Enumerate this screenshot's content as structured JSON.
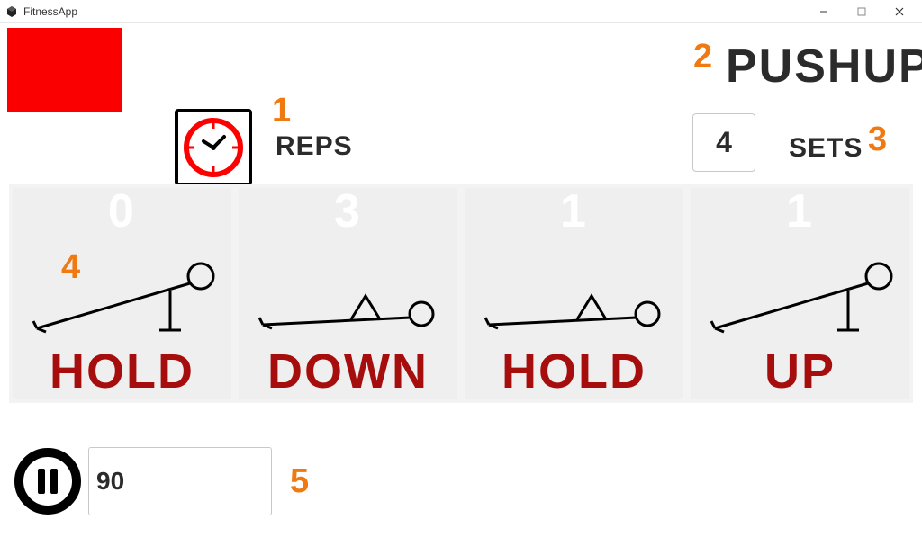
{
  "window": {
    "title": "FitnessApp"
  },
  "header": {
    "exercise_name": "PUSHUP",
    "reps_label": "REPS",
    "sets_label": "SETS",
    "sets_value": "4"
  },
  "annotations": {
    "n1": "1",
    "n2": "2",
    "n3": "3",
    "n4": "4",
    "n5": "5"
  },
  "stages": [
    {
      "count": "0",
      "label": "HOLD",
      "pose": "up"
    },
    {
      "count": "3",
      "label": "DOWN",
      "pose": "down"
    },
    {
      "count": "1",
      "label": "HOLD",
      "pose": "down"
    },
    {
      "count": "1",
      "label": "UP",
      "pose": "up"
    }
  ],
  "footer": {
    "bpm_value": "90"
  },
  "icons": {
    "unity": "unity-logo",
    "clock": "clock-icon",
    "pause": "pause-icon",
    "minimize": "window-minimize",
    "maximize": "window-maximize",
    "close": "window-close"
  },
  "colors": {
    "accent_red": "#fb0000",
    "label_red": "#a60e0e",
    "annotation_orange": "#ef7a11",
    "text_dark": "#2b2b2b"
  }
}
